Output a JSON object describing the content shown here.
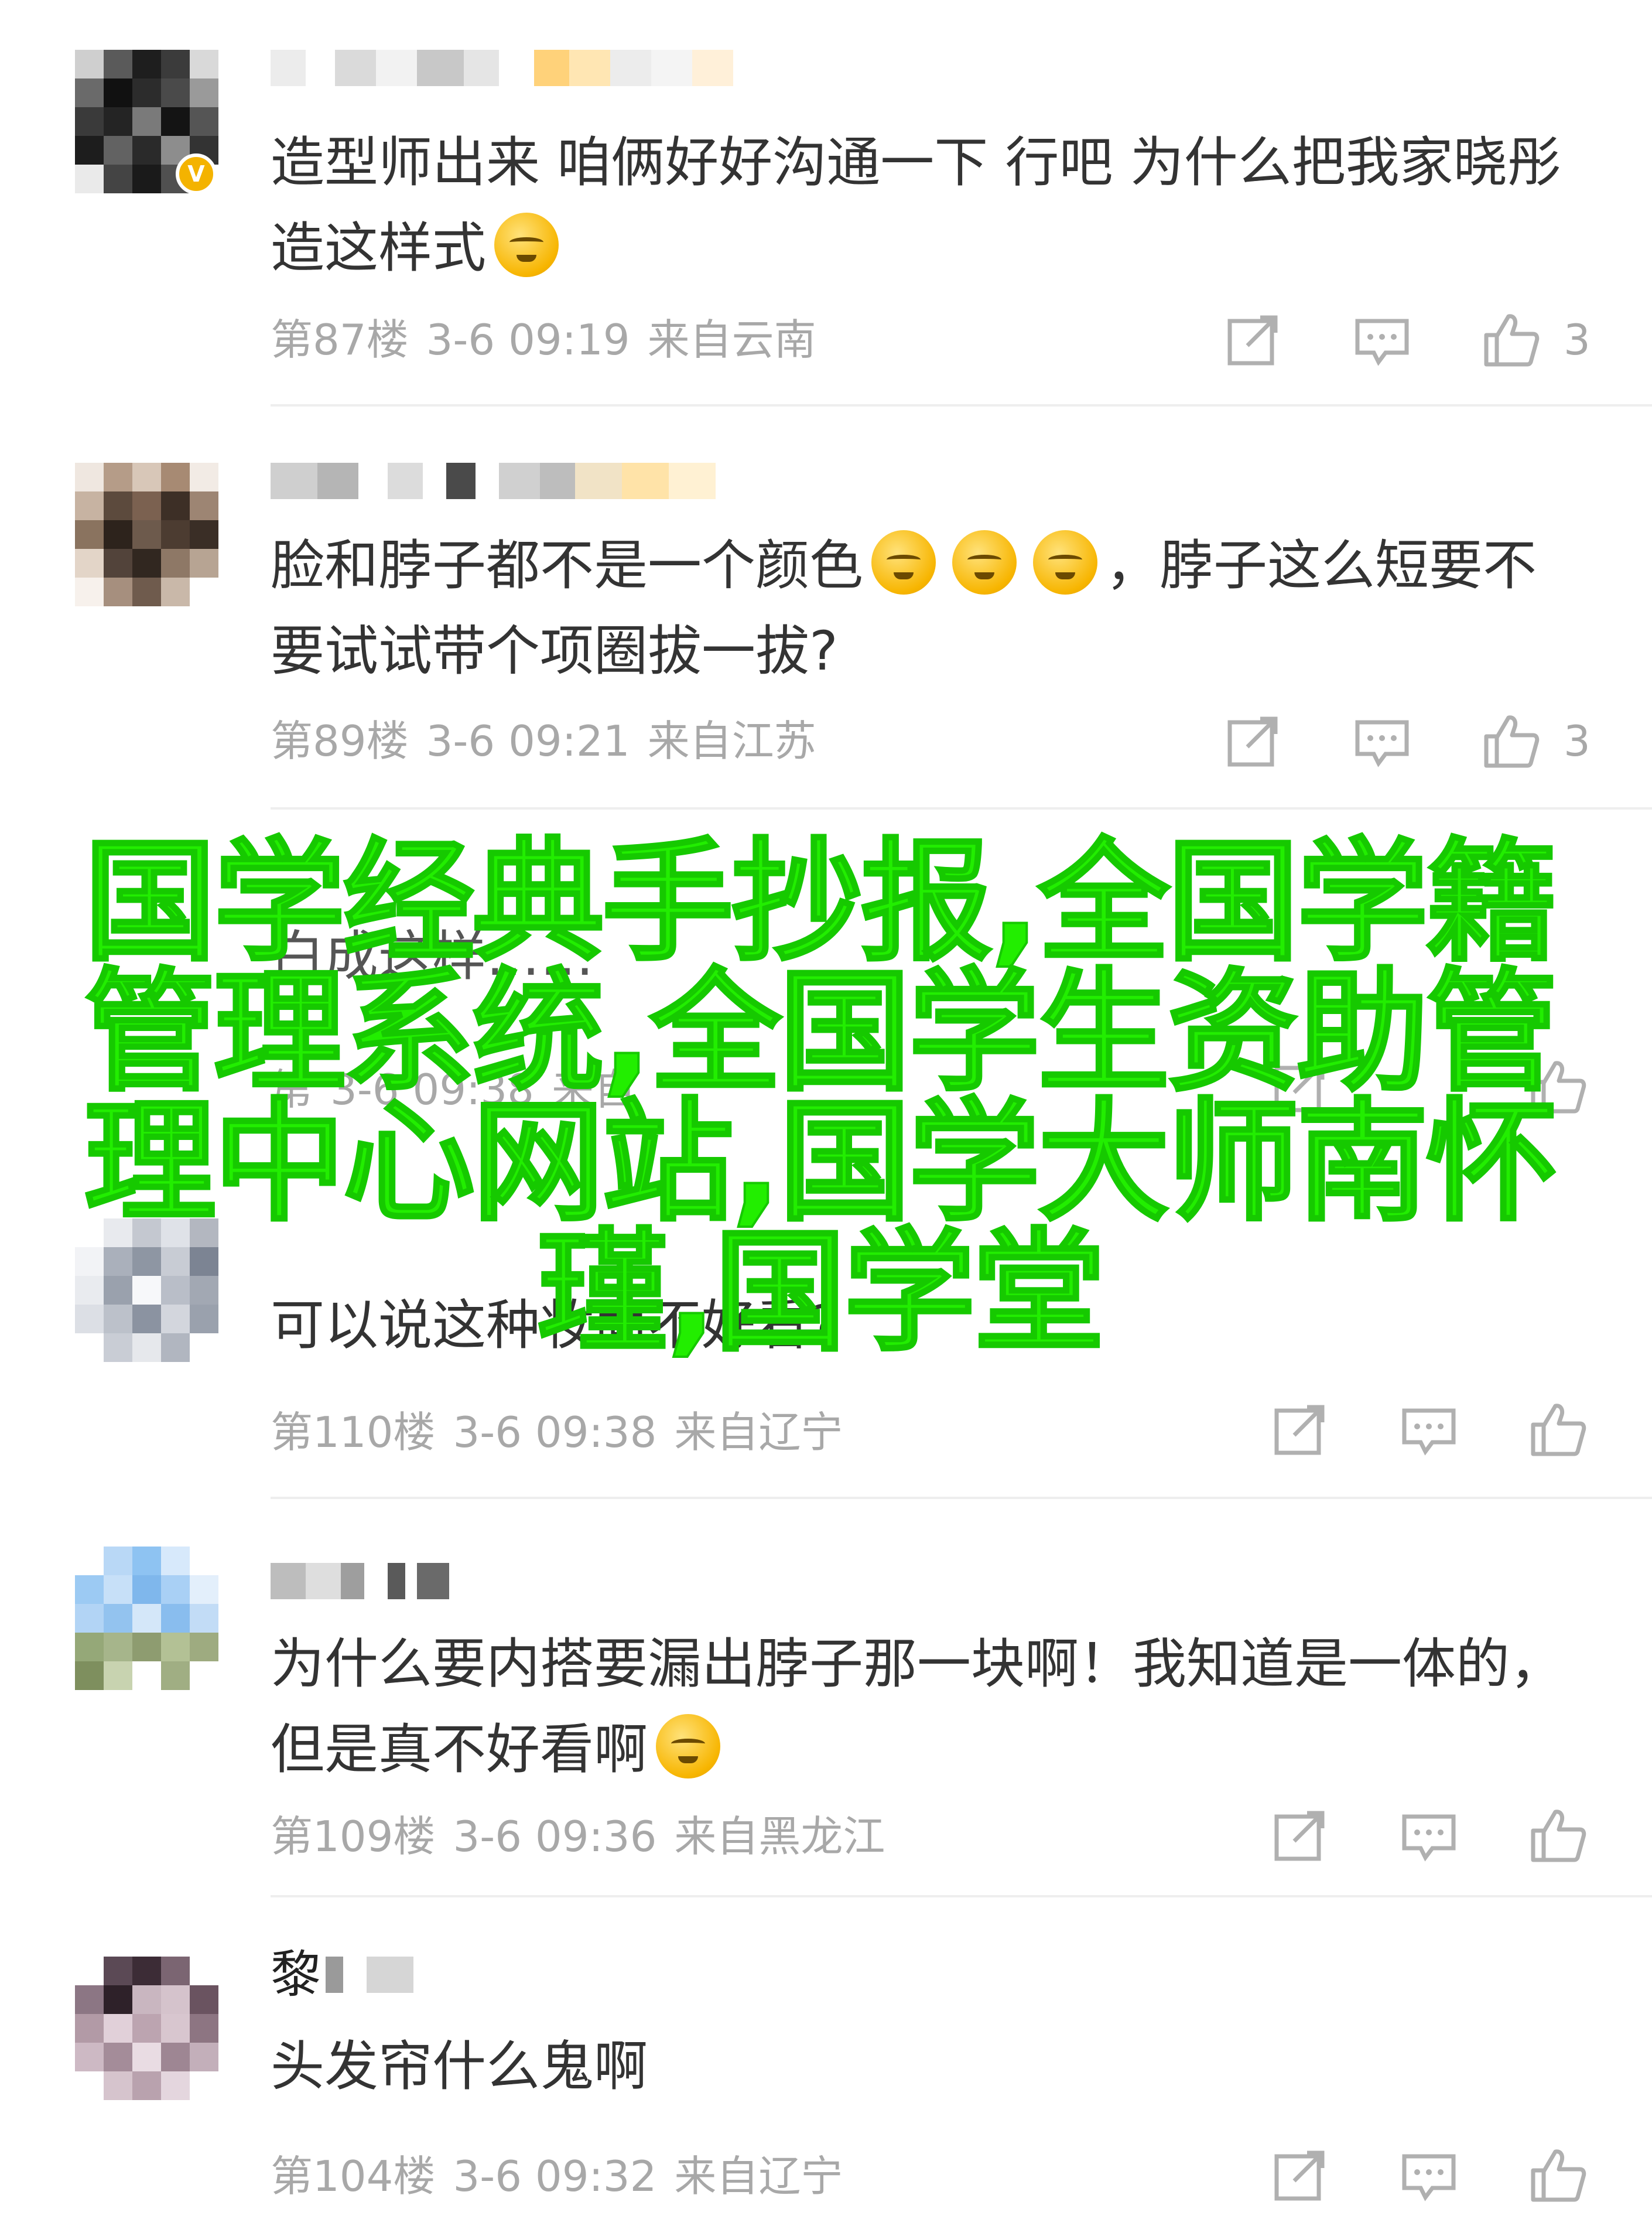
{
  "comments": [
    {
      "username": "",
      "verified_badge": "V",
      "text": "造型师出来 咱俩好好沟通一下 行吧 为什么把我家晓彤造这样式",
      "emojis": [
        "crying-face"
      ],
      "floor": "第87楼",
      "date": "3-6 09:19",
      "location": "来自云南",
      "likes": "3"
    },
    {
      "username": "",
      "text": "脸和脖子都不是一个颜色",
      "text_after_emoji": "，脖子这么短要不要试试带个项圈拔一拔?",
      "emojis": [
        "sad-sweat-face",
        "sad-sweat-face",
        "sad-sweat-face"
      ],
      "floor": "第89楼",
      "date": "3-6 09:21",
      "location": "来自江苏",
      "likes": "3"
    },
    {
      "username": "",
      "text": "白成这样……",
      "floor": "第",
      "date": "3-6 09:38",
      "location": "来自",
      "likes": ""
    },
    {
      "username": "",
      "text": "可以说这种妆面不好看?",
      "floor": "第110楼",
      "date": "3-6 09:38",
      "location": "来自辽宁",
      "likes": ""
    },
    {
      "username": "",
      "text": "为什么要内搭要漏出脖子那一块啊！我知道是一体的，但是真不好看啊",
      "emojis": [
        "dizzy-face"
      ],
      "floor": "第109楼",
      "date": "3-6 09:36",
      "location": "来自黑龙江",
      "likes": ""
    },
    {
      "username": "黎",
      "text": "头发帘什么鬼啊",
      "floor": "第104楼",
      "date": "3-6 09:32",
      "location": "来自辽宁",
      "likes": ""
    }
  ],
  "overlay": {
    "lines": [
      "国学经典手抄报,全国学籍",
      "管理系统,全国学生资助管",
      "理中心网站,国学大师南怀",
      "瑾,国学堂"
    ],
    "color": "#22ee00"
  },
  "icons": {
    "share": "share-icon",
    "comment": "comment-icon",
    "like": "thumbs-up-icon"
  },
  "colors": {
    "meta_text": "#a8a8a8",
    "body_text": "#333333",
    "divider": "#eeeeee",
    "badge": "#f4b300"
  }
}
